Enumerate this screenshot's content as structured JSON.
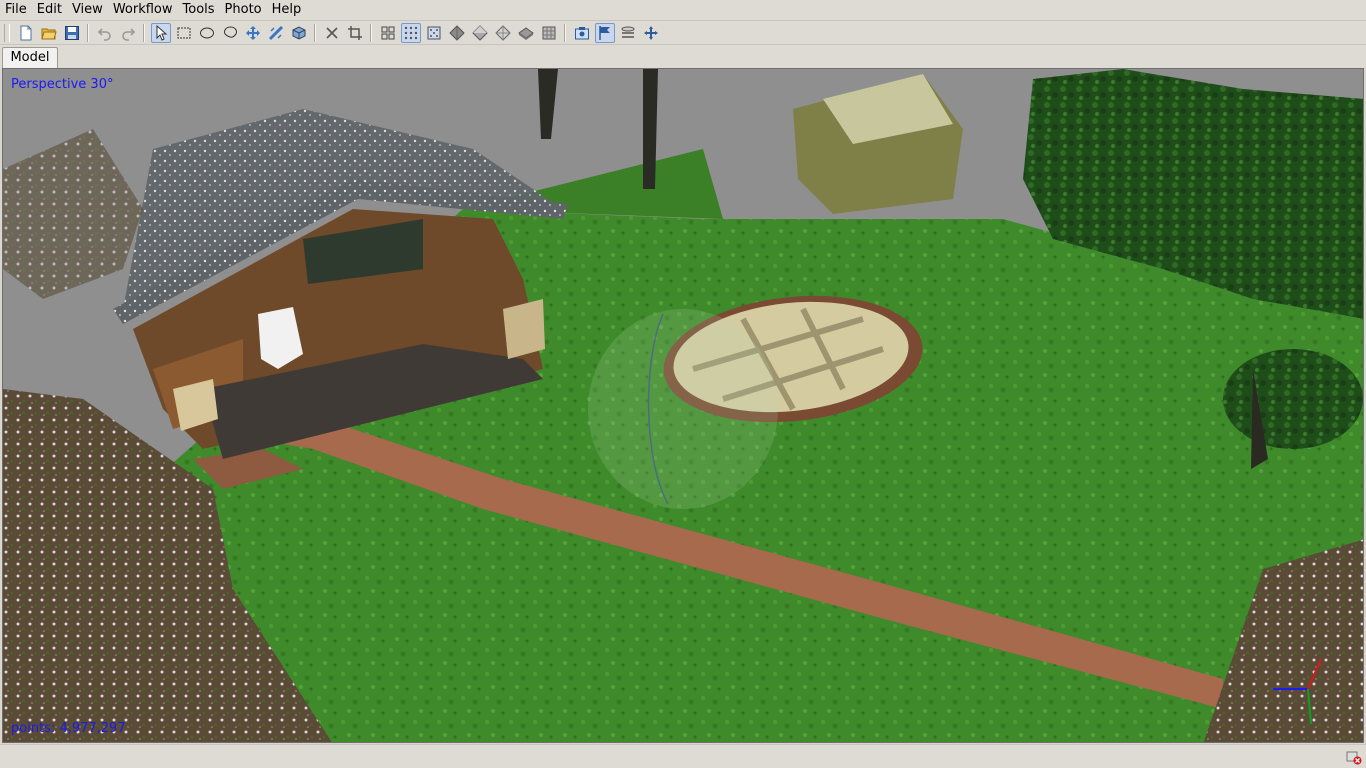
{
  "menu": {
    "items": [
      {
        "name": "menu-file",
        "label": "File"
      },
      {
        "name": "menu-edit",
        "label": "Edit"
      },
      {
        "name": "menu-view",
        "label": "View"
      },
      {
        "name": "menu-workflow",
        "label": "Workflow"
      },
      {
        "name": "menu-tools",
        "label": "Tools"
      },
      {
        "name": "menu-photo",
        "label": "Photo"
      },
      {
        "name": "menu-help",
        "label": "Help"
      }
    ]
  },
  "tabs": {
    "model": "Model"
  },
  "viewport": {
    "projection_label": "Perspective 30°",
    "points_label": "points: 4,977,297"
  },
  "colors": {
    "overlay_text": "#1a1af0",
    "grass": "#3f8a2a",
    "path": "#a86a4d",
    "background": "#8f8f8f",
    "toggle_active": "#c8d6ee"
  },
  "icons": {
    "toolbar": [
      "new-icon",
      "open-icon",
      "save-icon",
      "undo-icon",
      "redo-icon",
      "navigation-icon",
      "rectangle-selection-icon",
      "circle-selection-icon",
      "free-form-selection-icon",
      "resize-region-icon",
      "rotate-region-icon",
      "rotate-object-icon",
      "delete-selection-icon",
      "crop-selection-icon",
      "show-cameras-icon",
      "show-points-icon",
      "show-dense-cloud-icon",
      "show-model-solid-icon",
      "show-model-shaded-icon",
      "show-model-wireframe-icon",
      "show-model-textured-icon",
      "show-tiled-model-icon",
      "capture-view-icon",
      "show-markers-icon",
      "show-region-icon",
      "reset-view-icon"
    ],
    "status": "warning-icon"
  }
}
